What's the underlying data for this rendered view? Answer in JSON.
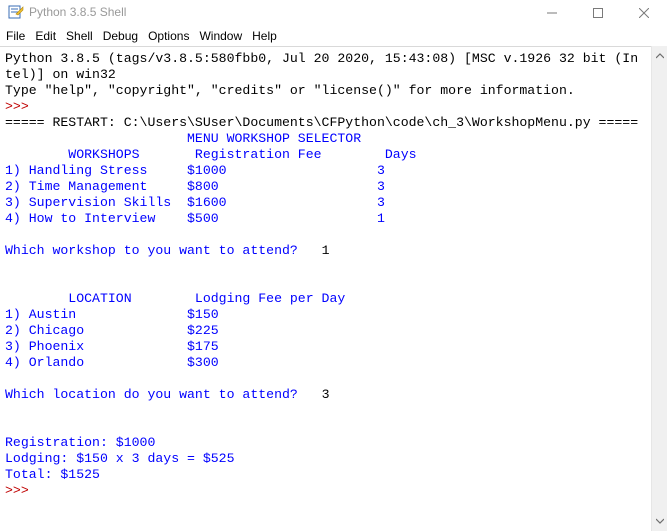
{
  "window": {
    "title": "Python 3.8.5 Shell",
    "controls": {
      "minimize": "—",
      "maximize": "☐",
      "close": "✕"
    }
  },
  "menu": [
    "File",
    "Edit",
    "Shell",
    "Debug",
    "Options",
    "Window",
    "Help"
  ],
  "console": {
    "banner1": "Python 3.8.5 (tags/v3.8.5:580fbb0, Jul 20 2020, 15:43:08) [MSC v.1926 32 bit (In",
    "banner2": "tel)] on win32",
    "banner3": "Type \"help\", \"copyright\", \"credits\" or \"license()\" for more information.",
    "prompt": ">>>",
    "restart": "===== RESTART: C:\\Users\\SUser\\Documents\\CFPython\\code\\ch_3\\WorkshopMenu.py =====",
    "menu_title": "                       MENU WORKSHOP SELECTOR",
    "workshop_header": "        WORKSHOPS       Registration Fee        Days",
    "workshop_rows": [
      "1) Handling Stress     $1000                   3",
      "2) Time Management     $800                    3",
      "3) Supervision Skills  $1600                   3",
      "4) How to Interview    $500                    1"
    ],
    "workshop_question": "Which workshop to you want to attend?   ",
    "workshop_answer": "1",
    "location_header": "        LOCATION        Lodging Fee per Day",
    "location_rows": [
      "1) Austin              $150",
      "2) Chicago             $225",
      "3) Phoenix             $175",
      "4) Orlando             $300"
    ],
    "location_question": "Which location do you want to attend?   ",
    "location_answer": "3",
    "registration": "Registration: $1000",
    "lodging": "Lodging: $150 x 3 days = $525",
    "total": "Total: $1525",
    "final_prompt": ">>>"
  },
  "colors": {
    "output": "#0000ff",
    "text": "#000000",
    "prompt": "#c00000"
  }
}
